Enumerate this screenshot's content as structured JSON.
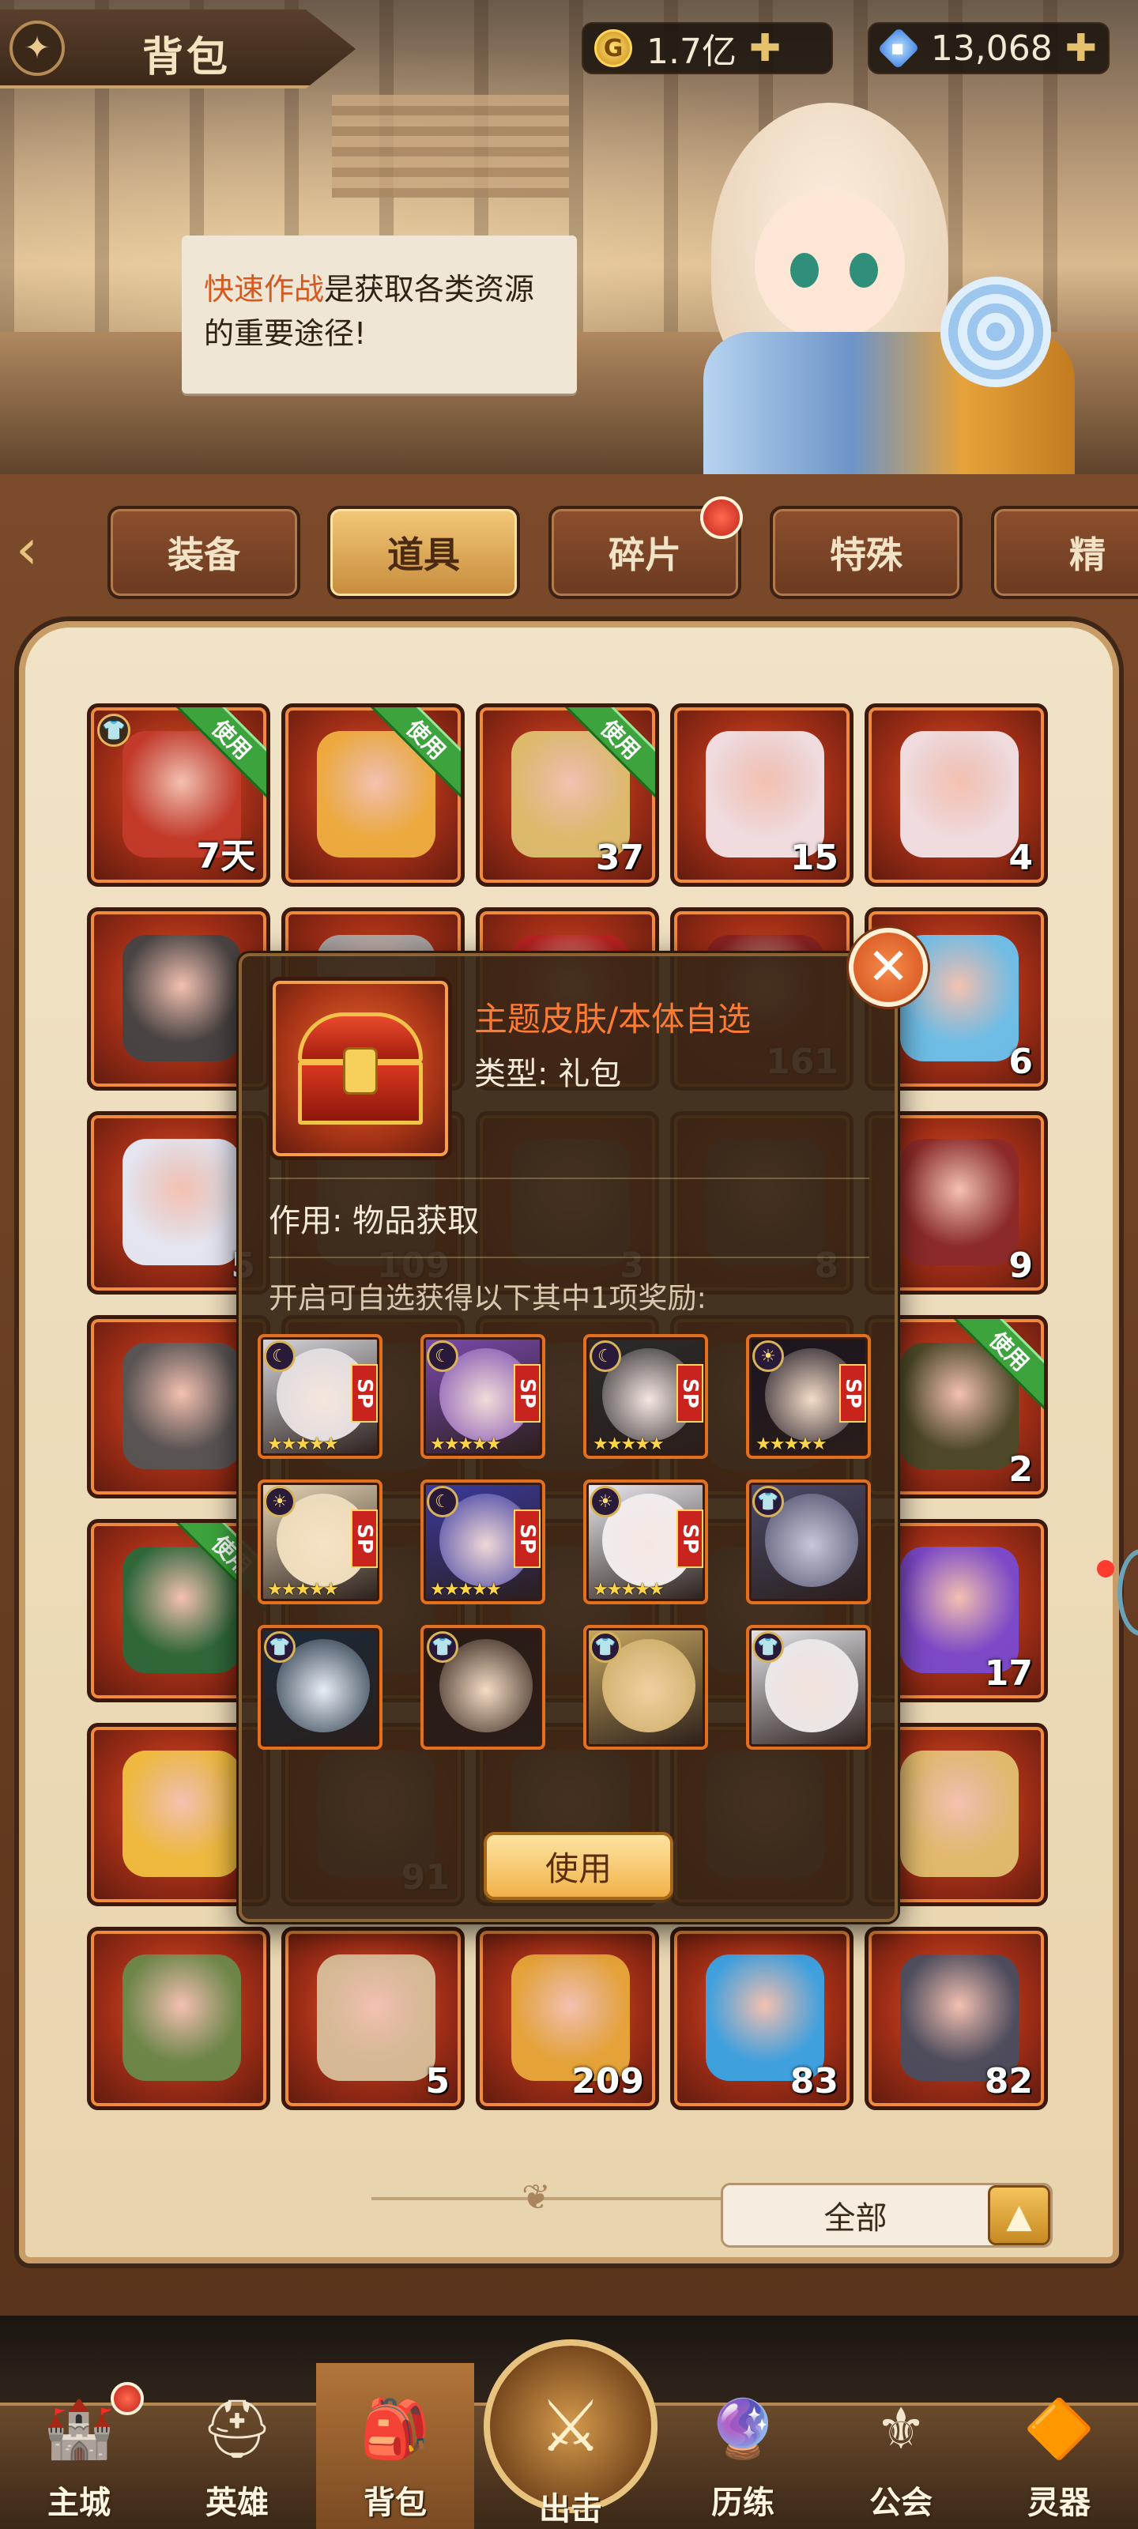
{
  "header": {
    "title": "背包",
    "gold": "1.7亿",
    "gems": "13,068",
    "gold_icon": "G"
  },
  "speech": {
    "highlight": "快速作战",
    "text": "是获取各类资源的重要途径!"
  },
  "tabs": [
    {
      "label": "装备",
      "active": false,
      "badge": false
    },
    {
      "label": "道具",
      "active": true,
      "badge": false
    },
    {
      "label": "碎片",
      "active": false,
      "badge": true
    },
    {
      "label": "特殊",
      "active": false,
      "badge": false
    },
    {
      "label": "精",
      "active": false,
      "badge": false
    }
  ],
  "grid": {
    "rows": [
      [
        {
          "count": "7天",
          "use": "使用",
          "tag": "👕",
          "art": "#c43a2a"
        },
        {
          "count": "",
          "use": "使用",
          "art": "#f0b040"
        },
        {
          "count": "37",
          "use": "使用",
          "art": "#e0c070"
        },
        {
          "count": "15",
          "art": "#f4e4e8"
        },
        {
          "count": "4",
          "art": "#f4e4e8"
        }
      ],
      [
        {
          "count": "",
          "art": "#444"
        },
        {
          "count": "",
          "art": "#aaa"
        },
        {
          "count": "",
          "art": "#b22"
        },
        {
          "count": "161",
          "art": "#822"
        },
        {
          "count": "6",
          "art": "#6cc4f0"
        }
      ],
      [
        {
          "count": "5",
          "art": "#e8eefa"
        },
        {
          "count": "109",
          "art": "#888"
        },
        {
          "count": "3",
          "art": "#777"
        },
        {
          "count": "8",
          "art": "#666"
        },
        {
          "count": "9",
          "art": "#8a2a2a"
        }
      ],
      [
        {
          "count": "",
          "art": "#555"
        },
        {
          "count": "",
          "art": "#777"
        },
        {
          "count": "",
          "art": "#777"
        },
        {
          "count": "",
          "art": "#777"
        },
        {
          "count": "2",
          "use": "使用",
          "art": "#4a4a2a"
        }
      ],
      [
        {
          "count": "",
          "use": "使用",
          "art": "#2a6a3a"
        },
        {
          "count": "",
          "art": "#777"
        },
        {
          "count": "",
          "art": "#777"
        },
        {
          "count": "",
          "art": "#777"
        },
        {
          "count": "17",
          "art": "#7a4ad0"
        }
      ],
      [
        {
          "count": "",
          "art": "#f2c040"
        },
        {
          "count": "91",
          "art": "#777"
        },
        {
          "count": "",
          "art": "#777"
        },
        {
          "count": "",
          "art": "#777"
        },
        {
          "count": "",
          "art": "#e4c070"
        }
      ],
      [
        {
          "count": "",
          "art": "#6a8a4a"
        },
        {
          "count": "5",
          "art": "#d8c09a"
        },
        {
          "count": "209",
          "art": "#e8a83a"
        },
        {
          "count": "83",
          "art": "#3aa6e8"
        },
        {
          "count": "82",
          "art": "#4a4e60"
        }
      ]
    ]
  },
  "filter": {
    "label": "全部",
    "button_icon": "▲"
  },
  "popup": {
    "name": "主题皮肤/本体自选",
    "type": "类型: 礼包",
    "effect": "作用: 物品获取",
    "description": "开启可自选获得以下其中1项奖励:",
    "use_label": "使用",
    "close_icon": "✕",
    "heroes": [
      {
        "hair": "#d8d8e0",
        "face": "#f6e6dc",
        "badge": "☾",
        "sp": "SP",
        "stars": "★★★★★"
      },
      {
        "hair": "#7a4ab0",
        "face": "#f2dcd8",
        "badge": "☾",
        "sp": "SP",
        "stars": "★★★★★"
      },
      {
        "hair": "#2a2a2a",
        "face": "#f6e6e2",
        "badge": "☾",
        "sp": "SP",
        "stars": "★★★★★"
      },
      {
        "hair": "#1a1420",
        "face": "#f4dcc8",
        "badge": "☀",
        "sp": "SP",
        "stars": "★★★★★"
      },
      {
        "hair": "#e8d8b8",
        "face": "#f6e2c4",
        "badge": "☀",
        "sp": "SP",
        "stars": "★★★★★"
      },
      {
        "hair": "#3a3aa0",
        "face": "#f0d8d8",
        "badge": "☾",
        "sp": "SP",
        "stars": "★★★★★"
      },
      {
        "hair": "#eeeef4",
        "face": "#f6e6e0",
        "badge": "☀",
        "sp": "SP",
        "stars": "★★★★★"
      },
      {
        "hair": "#4a4a6a",
        "face": "#c8c8d8",
        "badge": "👕",
        "sp": "",
        "stars": ""
      },
      {
        "hair": "#1a2a3a",
        "face": "#e8eef6",
        "badge": "👕",
        "sp": "",
        "stars": ""
      },
      {
        "hair": "#2a1a14",
        "face": "#f4dcc4",
        "badge": "👕",
        "sp": "",
        "stars": ""
      },
      {
        "hair": "#c8a860",
        "face": "#f0d0a0",
        "badge": "👕",
        "sp": "",
        "stars": ""
      },
      {
        "hair": "#e8e8ee",
        "face": "#f2e2da",
        "badge": "👕",
        "sp": "",
        "stars": ""
      }
    ]
  },
  "nav": [
    {
      "label": "主城",
      "icon": "🏰",
      "active": false,
      "badge": true
    },
    {
      "label": "英雄",
      "icon": "⛑",
      "active": false,
      "badge": false
    },
    {
      "label": "背包",
      "icon": "🎒",
      "active": true,
      "badge": false
    },
    {
      "label": "历练",
      "icon": "🔮",
      "active": false,
      "badge": false
    },
    {
      "label": "公会",
      "icon": "⚜",
      "active": false,
      "badge": false
    },
    {
      "label": "灵器",
      "icon": "🔶",
      "active": false,
      "badge": false
    }
  ],
  "nav_center": {
    "label": "出击",
    "icon": "⚔"
  }
}
